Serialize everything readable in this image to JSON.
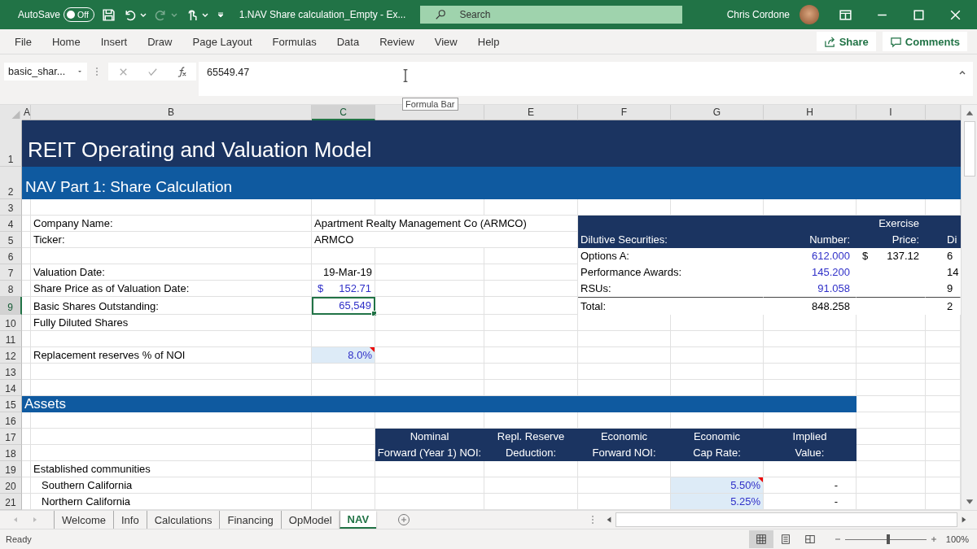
{
  "title_bar": {
    "autosave_label": "AutoSave",
    "autosave_toggle": {
      "label": "Off",
      "on": false
    },
    "redo": {
      "disabled": true
    },
    "document_title": "1.NAV Share calculation_Empty  -  Ex...",
    "search_placeholder": "Search",
    "user_name": "Chris Cordone"
  },
  "ribbon_tabs": [
    "File",
    "Home",
    "Insert",
    "Draw",
    "Page Layout",
    "Formulas",
    "Data",
    "Review",
    "View",
    "Help"
  ],
  "share_button": "Share",
  "comments_button": "Comments",
  "formula_bar": {
    "name_box": "basic_shar...",
    "value": "65549.47",
    "tooltip": "Formula Bar"
  },
  "columns": [
    {
      "label": "A",
      "selected": false
    },
    {
      "label": "B",
      "selected": false
    },
    {
      "label": "C",
      "selected": true
    },
    {
      "selected": false
    },
    {
      "label": "E",
      "selected": false
    },
    {
      "label": "F",
      "selected": false
    },
    {
      "label": "G",
      "selected": false
    },
    {
      "label": "H",
      "selected": false
    },
    {
      "label": "I",
      "selected": false
    },
    {
      "selected": false
    }
  ],
  "rows": [
    {
      "num": "1",
      "selected": false,
      "band": {
        "kind": "title",
        "text": "REIT Operating and Valuation Model"
      }
    },
    {
      "num": "2",
      "selected": false,
      "band": {
        "kind": "subtitle",
        "text": "NAV Part 1: Share Calculation"
      }
    },
    {
      "num": "3",
      "selected": false
    },
    {
      "num": "4",
      "selected": false,
      "label": {
        "text": "Company Name:"
      },
      "value": {
        "kind": "text",
        "text": "Apartment Realty Management Co (ARMCO)"
      },
      "dilutive": {
        "kind": "heading",
        "price": "Exercise"
      }
    },
    {
      "num": "5",
      "selected": false,
      "label": {
        "text": "Ticker:"
      },
      "value": {
        "kind": "text",
        "text": "ARMCO"
      },
      "dilutive": {
        "kind": "heading",
        "name": "Dilutive Securities:",
        "number": "Number:",
        "price": "Price:",
        "diluted": "Di"
      }
    },
    {
      "num": "6",
      "selected": false,
      "dilutive": {
        "kind": "security",
        "name": "Options A:",
        "number": "612.000",
        "symbol": "$",
        "price": "137.12",
        "diluted": "6"
      }
    },
    {
      "num": "7",
      "selected": false,
      "label": {
        "text": "Valuation Date:"
      },
      "value": {
        "kind": "value",
        "text": "19-Mar-19"
      },
      "dilutive": {
        "kind": "security",
        "name": "Performance Awards:",
        "number": "145.200",
        "diluted": "14"
      }
    },
    {
      "num": "8",
      "selected": false,
      "label": {
        "text": "Share Price as of Valuation Date:"
      },
      "value": {
        "kind": "input",
        "symbol": "$",
        "text": "152.71"
      },
      "dilutive": {
        "kind": "security",
        "name": "RSUs:",
        "number": "91.058",
        "diluted": "9"
      }
    },
    {
      "num": "9",
      "selected": true,
      "label": {
        "text": "Basic Shares Outstanding:"
      },
      "value": {
        "kind": "input",
        "selected": true,
        "text": "65,549"
      },
      "dilutive": {
        "kind": "total",
        "name": "Total:",
        "number": "848.258",
        "diluted": "2"
      }
    },
    {
      "num": "10",
      "selected": false,
      "label": {
        "text": "Fully Diluted Shares"
      }
    },
    {
      "num": "11",
      "selected": false
    },
    {
      "num": "12",
      "selected": false,
      "label": {
        "text": "Replacement reserves % of NOI"
      },
      "value": {
        "kind": "input",
        "fill": true,
        "comment": true,
        "text": "8.0%"
      }
    },
    {
      "num": "13",
      "selected": false
    },
    {
      "num": "14",
      "selected": false
    },
    {
      "num": "15",
      "selected": false,
      "band": {
        "kind": "section",
        "text": "Assets"
      }
    },
    {
      "num": "16",
      "selected": false
    },
    {
      "num": "17",
      "selected": false,
      "asset_headers": [
        "Nominal",
        "Repl. Reserve",
        "Economic",
        "Economic",
        "Implied"
      ]
    },
    {
      "num": "18",
      "selected": false,
      "asset_headers": [
        "Forward (Year 1) NOI:",
        "Deduction:",
        "Forward NOI:",
        "Cap Rate:",
        "Value:"
      ]
    },
    {
      "num": "19",
      "selected": false,
      "label": {
        "text": "Established communities"
      }
    },
    {
      "num": "20",
      "selected": false,
      "label": {
        "text": "Southern California",
        "indent": true
      },
      "cap_rate": {
        "text": "5.50%",
        "fill": true,
        "comment": true
      },
      "implied_value": "-"
    },
    {
      "num": "21",
      "selected": false,
      "label": {
        "text": "Northern California",
        "indent": true
      },
      "cap_rate": {
        "text": "5.25%",
        "fill": true,
        "comment": false
      },
      "implied_value": "-"
    }
  ],
  "sheet_tabs": [
    {
      "label": "Welcome",
      "selected": false
    },
    {
      "label": "Info",
      "selected": false
    },
    {
      "label": "Calculations",
      "selected": false
    },
    {
      "label": "Financing",
      "selected": false
    },
    {
      "label": "OpModel",
      "selected": false
    },
    {
      "label": "NAV",
      "selected": true
    }
  ],
  "status_bar": {
    "status": "Ready",
    "views": [
      {
        "kind": "normal",
        "selected": true
      },
      {
        "kind": "page-layout",
        "selected": false
      },
      {
        "kind": "page-break",
        "selected": false
      }
    ],
    "zoom_slider": {
      "level": 0.53
    },
    "zoom": "100%"
  }
}
